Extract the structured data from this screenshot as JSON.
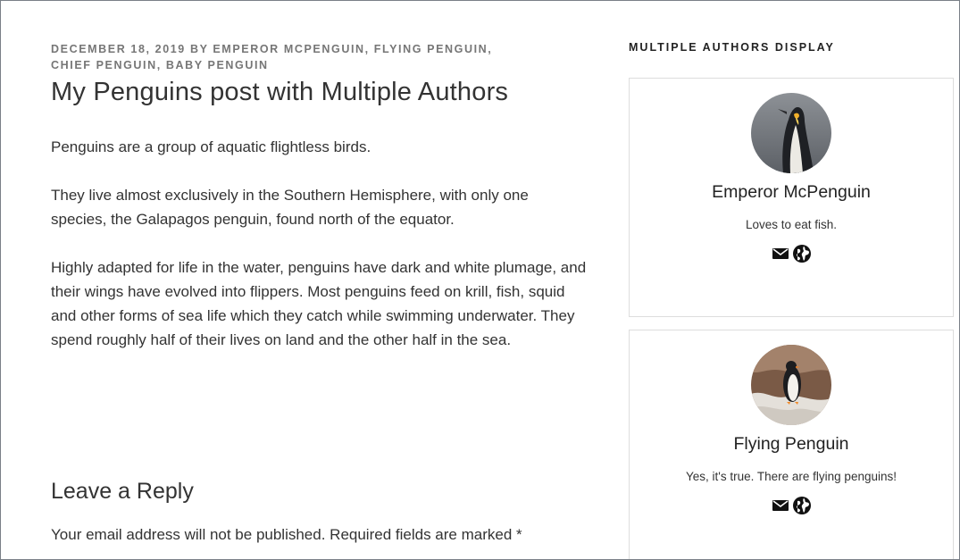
{
  "post": {
    "meta_date": "December 18, 2019",
    "meta_by": "by",
    "meta_authors": "Emperor McPenguin, Flying Penguin,",
    "meta_authors_2": "Chief Penguin, Baby Penguin",
    "title": "My Penguins post with Multiple Authors",
    "paragraphs": [
      "Penguins are a group of aquatic flightless birds.",
      "They live almost exclusively in the Southern Hemisphere, with only one species, the Galapagos penguin, found north of the equator.",
      "Highly adapted for life in the water, penguins have dark and white plumage, and their wings have evolved into flippers. Most penguins feed on krill, fish, squid and other forms of sea life which they catch while swimming underwater. They spend roughly half of their lives on land and the other half in the sea."
    ]
  },
  "reply": {
    "title": "Leave a Reply",
    "note": "Your email address will not be published. Required fields are marked *"
  },
  "sidebar": {
    "widget_title": "Multiple Authors Display",
    "authors": [
      {
        "name": "Emperor McPenguin",
        "bio": "Loves to eat fish.",
        "icons": [
          "email-icon",
          "website-globe-icon"
        ]
      },
      {
        "name": "Flying Penguin",
        "bio": "Yes, it's true. There are flying penguins!",
        "icons": [
          "email-icon",
          "website-globe-icon"
        ]
      }
    ]
  },
  "colors": {
    "meta": "#767676",
    "text": "#333333",
    "card_border": "#dddddd",
    "frame_border": "#7a7f87"
  }
}
